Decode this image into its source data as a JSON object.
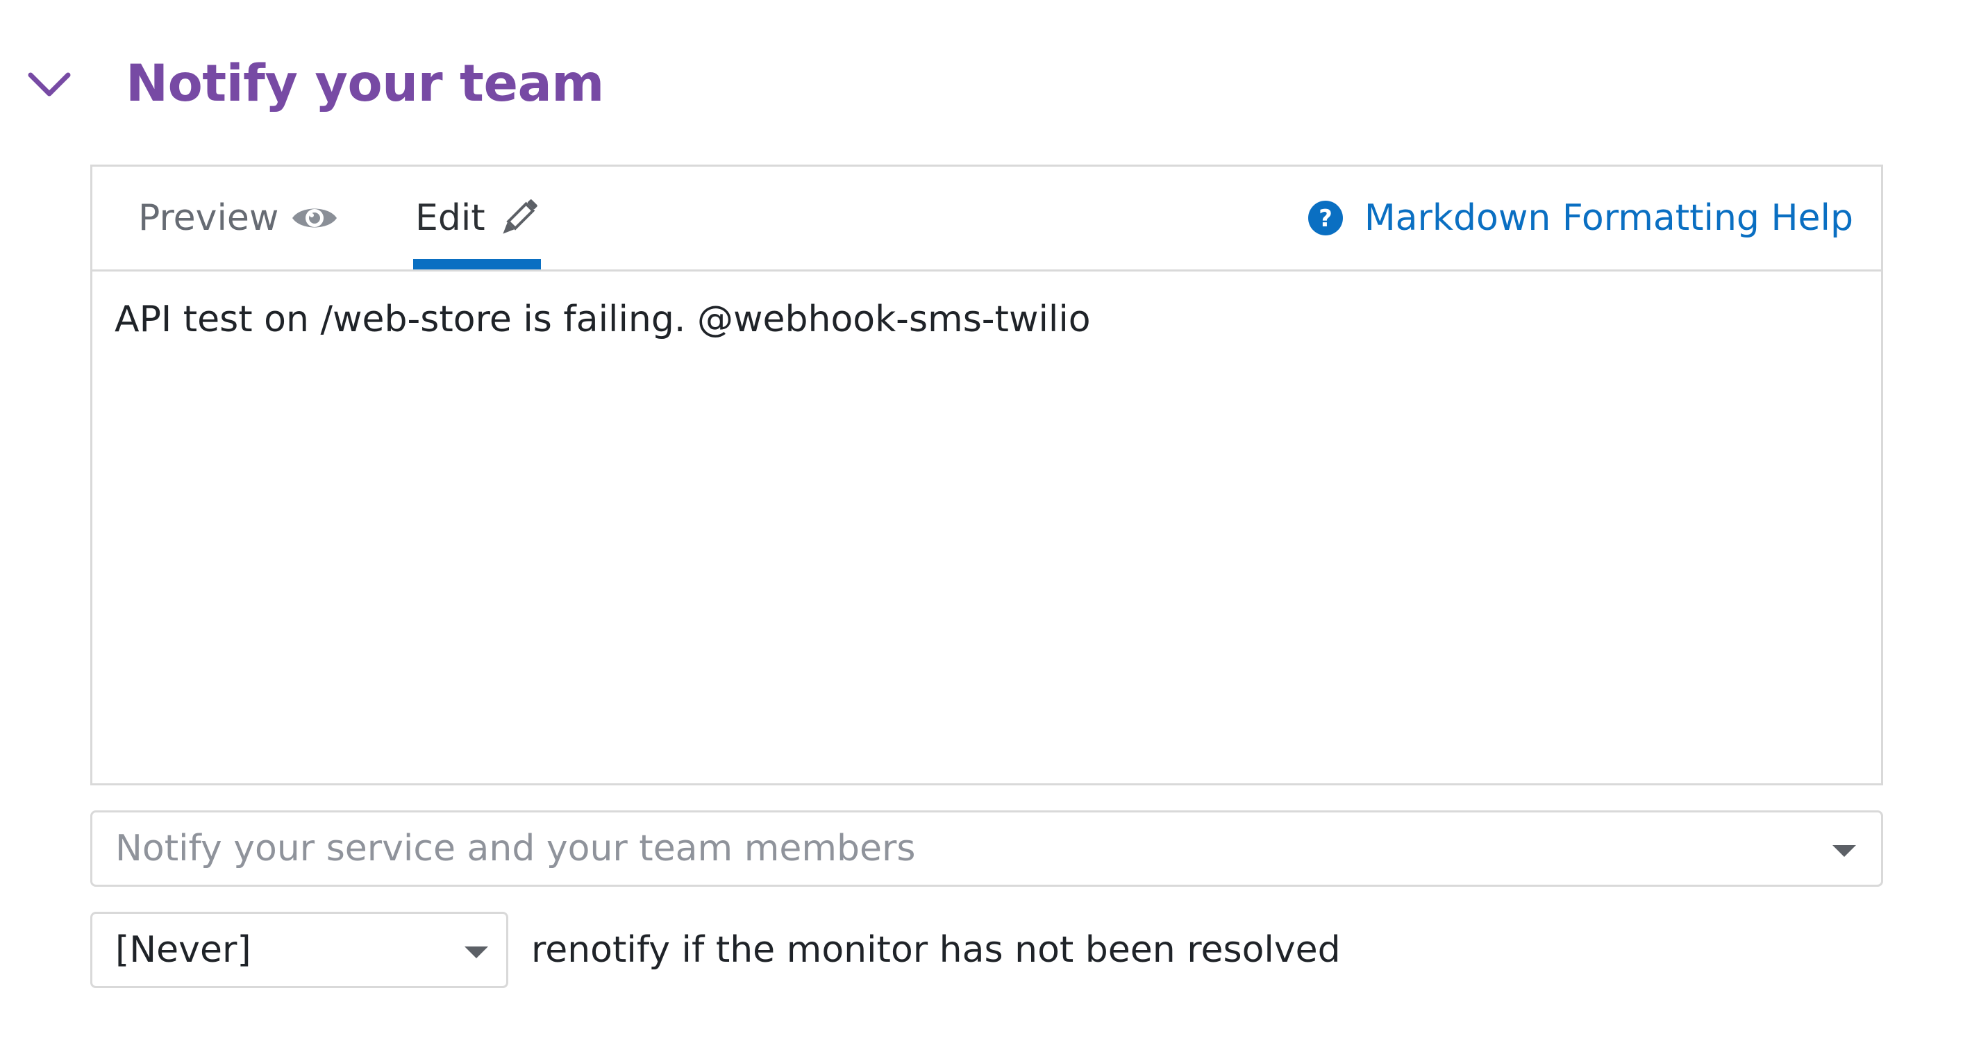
{
  "section": {
    "title": "Notify your team",
    "title_color": "#774aa4",
    "expand_icon": "chevron-down-icon"
  },
  "editor": {
    "tabs": [
      {
        "label": "Preview",
        "icon": "eye-icon",
        "active": false
      },
      {
        "label": "Edit",
        "icon": "pencil-icon",
        "active": true
      }
    ],
    "help_link": {
      "label": "Markdown Formatting Help",
      "icon": "question-circle-icon"
    },
    "message": "API test on /web-store is failing. @webhook-sms-twilio",
    "accent_color": "#0a6fc2"
  },
  "notify_select": {
    "placeholder": "Notify your service and your team members",
    "icon": "caret-down-icon"
  },
  "renotify": {
    "selected": "[Never]",
    "label": "renotify if the monitor has not been resolved",
    "icon": "caret-down-icon"
  }
}
